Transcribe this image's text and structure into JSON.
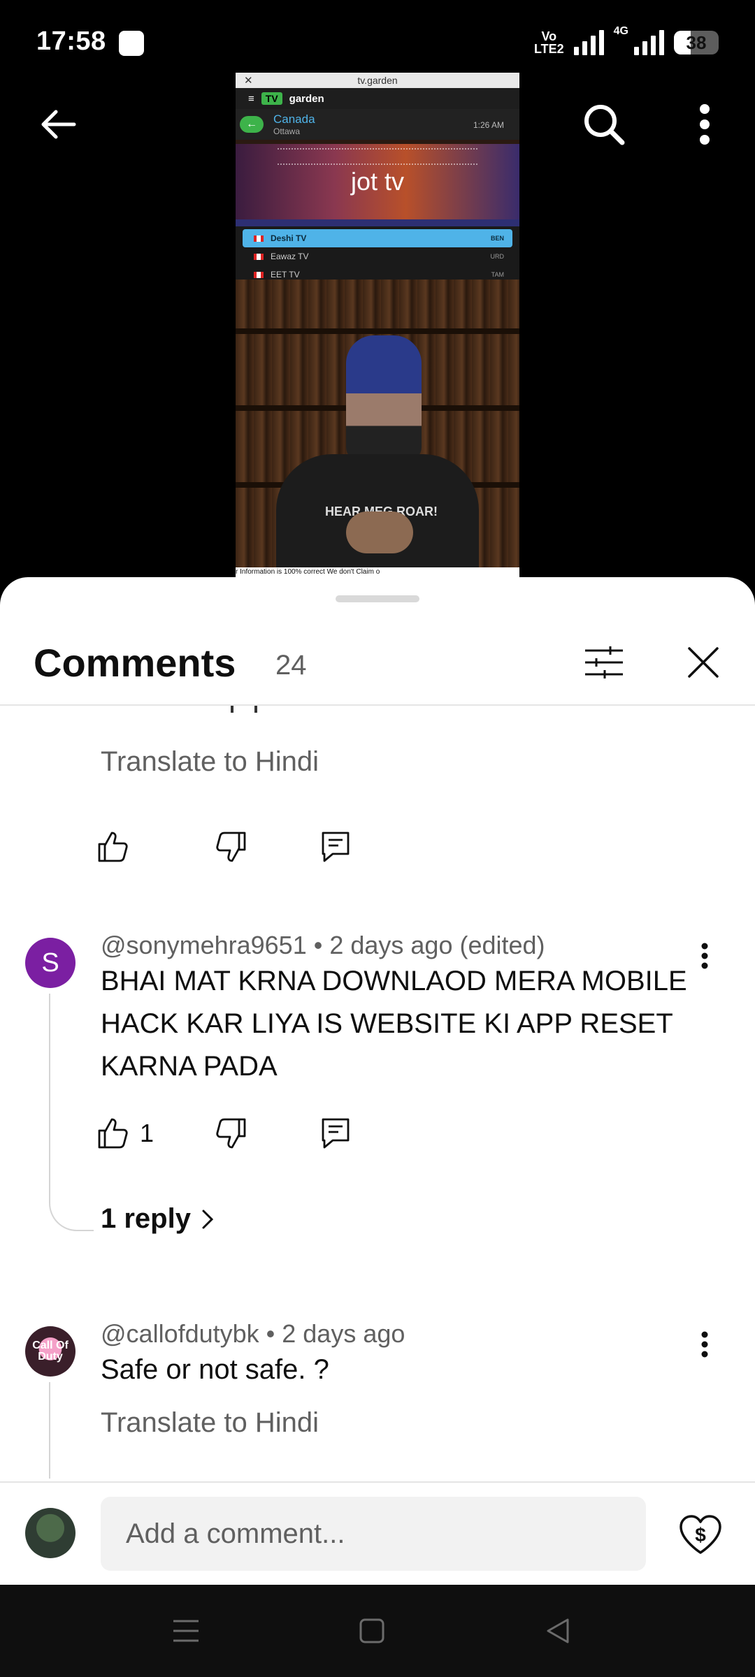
{
  "status_bar": {
    "time": "17:58",
    "network_label_top": "Vo",
    "network_label_bottom": "LTE2",
    "network_type": "4G",
    "battery_level": 38
  },
  "video": {
    "url": "tv.garden",
    "brand": "garden",
    "brand_badge": "TV",
    "country": "Canada",
    "city": "Ottawa",
    "clock": "1:26 AM",
    "banner_title": "jot tv",
    "channels": [
      {
        "name": "Deshi TV",
        "lang": "BEN",
        "active": true
      },
      {
        "name": "Eawaz TV",
        "lang": "URD",
        "active": false
      },
      {
        "name": "EET TV",
        "lang": "TAM",
        "active": false
      }
    ],
    "shirt_text": "HEAR MEG ROAR!",
    "bottom_ticker": "r Information is 100% correct          We don't Claim o"
  },
  "comments_panel": {
    "title": "Comments",
    "count": "24",
    "translate_label": "Translate to Hindi",
    "comments": [
      {
        "author": "@sonymehra9651",
        "meta_sep": " • ",
        "time": "2 days ago (edited)",
        "avatar_letter": "S",
        "text": "BHAI MAT KRNA DOWNLAOD MERA MOBILE HACK KAR LIYA IS WEBSITE KI APP RESET KARNA PADA",
        "likes": "1",
        "replies_label": "1 reply"
      },
      {
        "author": "@callofdutybk",
        "meta_sep": " • ",
        "time": "2 days ago",
        "avatar_text": "Call Of Duty",
        "text": "Safe or not safe.  ?",
        "translate_label": "Translate to Hindi"
      }
    ],
    "compose_placeholder": "Add a comment..."
  },
  "colors": {
    "avatar_s": "#7b1fa2",
    "secondary_text": "#606060",
    "primary_text": "#0f0f0f",
    "tv_green": "#3db34a",
    "channel_highlight": "#4fb3e8"
  },
  "icons": [
    "back-arrow-icon",
    "search-icon",
    "more-vert-icon",
    "filter-icon",
    "close-icon",
    "thumb-up-icon",
    "thumb-down-icon",
    "reply-icon",
    "chevron-right-icon",
    "thanks-heart-dollar-icon",
    "menu-icon",
    "home-square-icon",
    "back-triangle-icon"
  ]
}
